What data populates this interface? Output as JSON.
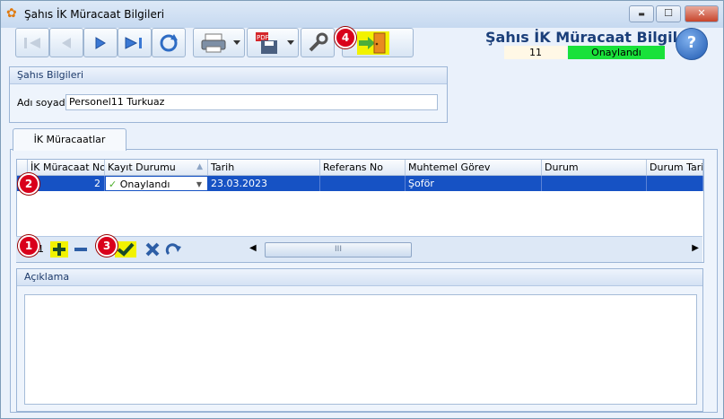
{
  "window": {
    "title": "Şahıs İK Müracaat Bilgileri",
    "controls": {
      "minimize": "▬",
      "maximize": "☐",
      "close": "✕"
    }
  },
  "header": {
    "form_title": "Şahıs İK Müracaat Bilgileri",
    "record_no": "11",
    "record_status": "Onaylandı",
    "help_label": "?"
  },
  "person_group": {
    "title": "Şahıs Bilgileri",
    "name_label": "Adı soyadı",
    "name_value": "Personel11 Turkuaz"
  },
  "tab": {
    "label": "İK Müracaatlar"
  },
  "grid": {
    "columns": [
      "İK Müracaat No",
      "Kayıt Durumu",
      "Tarih",
      "Referans No",
      "Muhtemel Görev",
      "Durum",
      "Durum Tarihi"
    ],
    "row": {
      "no": "2",
      "status": "Onaylandı",
      "date": "23.03.2023",
      "reference": "",
      "role": "Şoför",
      "state": "",
      "state_date": ""
    },
    "navigator_count": "1",
    "scroll_grip": "III"
  },
  "description_group": {
    "title": "Açıklama"
  },
  "badges": {
    "b1": "1",
    "b2": "2",
    "b3": "3",
    "b4": "4"
  },
  "colors": {
    "status_green": "#19e13a",
    "selection_blue": "#1652c4",
    "highlight_yellow": "#f2f200",
    "badge_red": "#d9001b"
  }
}
